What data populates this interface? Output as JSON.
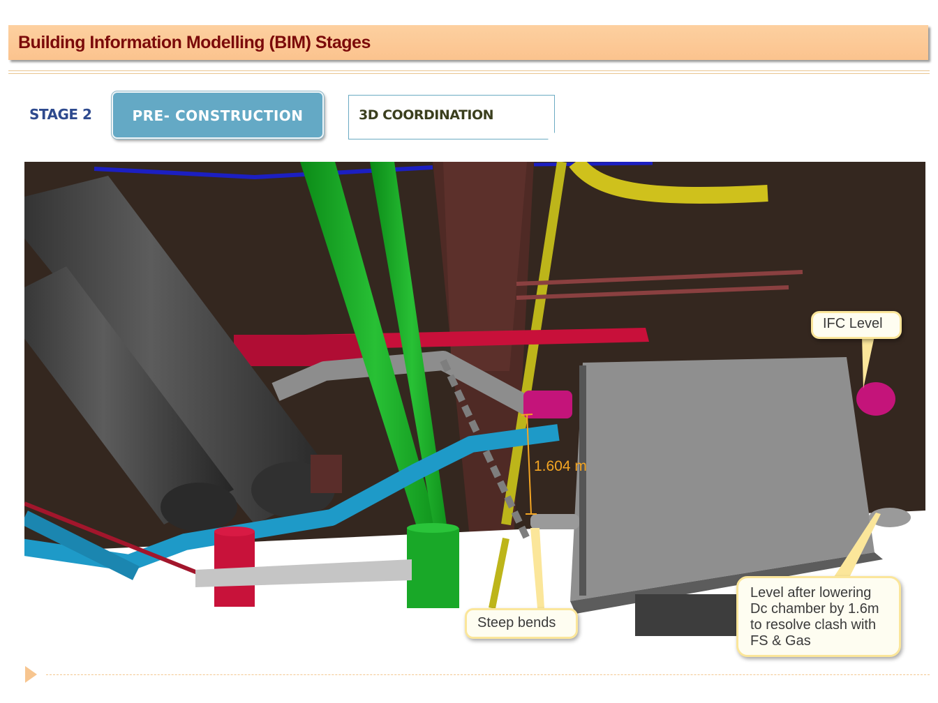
{
  "header": {
    "title": "Building Information Modelling (BIM) Stages"
  },
  "stage": {
    "label": "STAGE 2",
    "phase": "PRE- CONSTRUCTION",
    "activity": "3D COORDINATION"
  },
  "model_view": {
    "measurement": "1.604 m",
    "callouts": {
      "ifc_level": "IFC Level",
      "steep_bends": "Steep bends",
      "lowered_level": [
        "Level after lowering",
        "Dc chamber by 1.6m",
        "to resolve clash with",
        "FS & Gas"
      ]
    }
  },
  "colors": {
    "title_bar": "#fbc38e",
    "title_text": "#7b0a0a",
    "phase_button": "#64a9c5",
    "stage_text": "#2e4a8e",
    "measure_text": "#f5a623",
    "callout_border": "#fbe69a"
  },
  "footer": {
    "icons": [
      "play-arrow-icon"
    ]
  }
}
